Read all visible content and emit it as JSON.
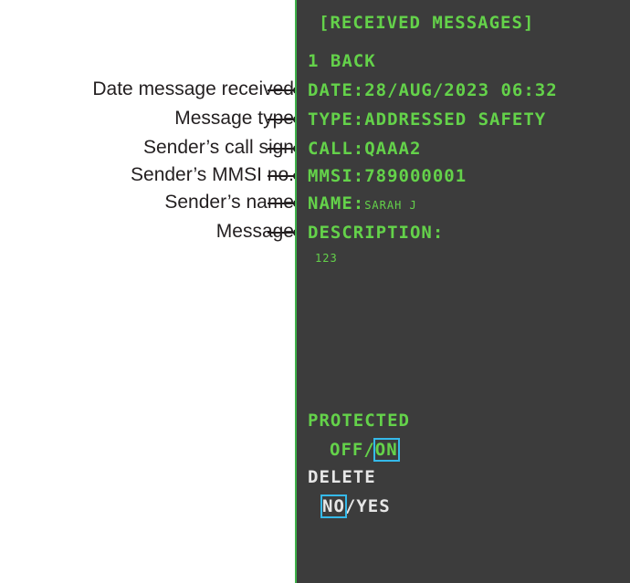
{
  "callouts": [
    "Date message received",
    "Message type",
    "Sender’s call sign",
    "Sender’s MMSI no.",
    "Sender’s name",
    "Message"
  ],
  "screen": {
    "title": "[RECEIVED MESSAGES]",
    "back": "1 BACK",
    "date": "DATE:28/AUG/2023 06:32",
    "type": "TYPE:ADDRESSED SAFETY",
    "call": "CALL:QAAA2",
    "mmsi": "MMSI:789000001",
    "name_label": "NAME:",
    "name_value": "SARAH J",
    "description_label": "DESCRIPTION:",
    "description_value": "123",
    "protected_label": "PROTECTED",
    "protected_off": "OFF",
    "protected_sep": "/",
    "protected_on": "ON",
    "delete_label": "DELETE",
    "delete_no": "NO",
    "delete_sep": "/",
    "delete_yes": "YES"
  },
  "colors": {
    "screen_bg": "#3c3c3c",
    "text_green": "#64d24a",
    "text_white": "#e6e6e6",
    "cursor_box": "#35b9e9",
    "frame_green": "#3fb14a"
  }
}
